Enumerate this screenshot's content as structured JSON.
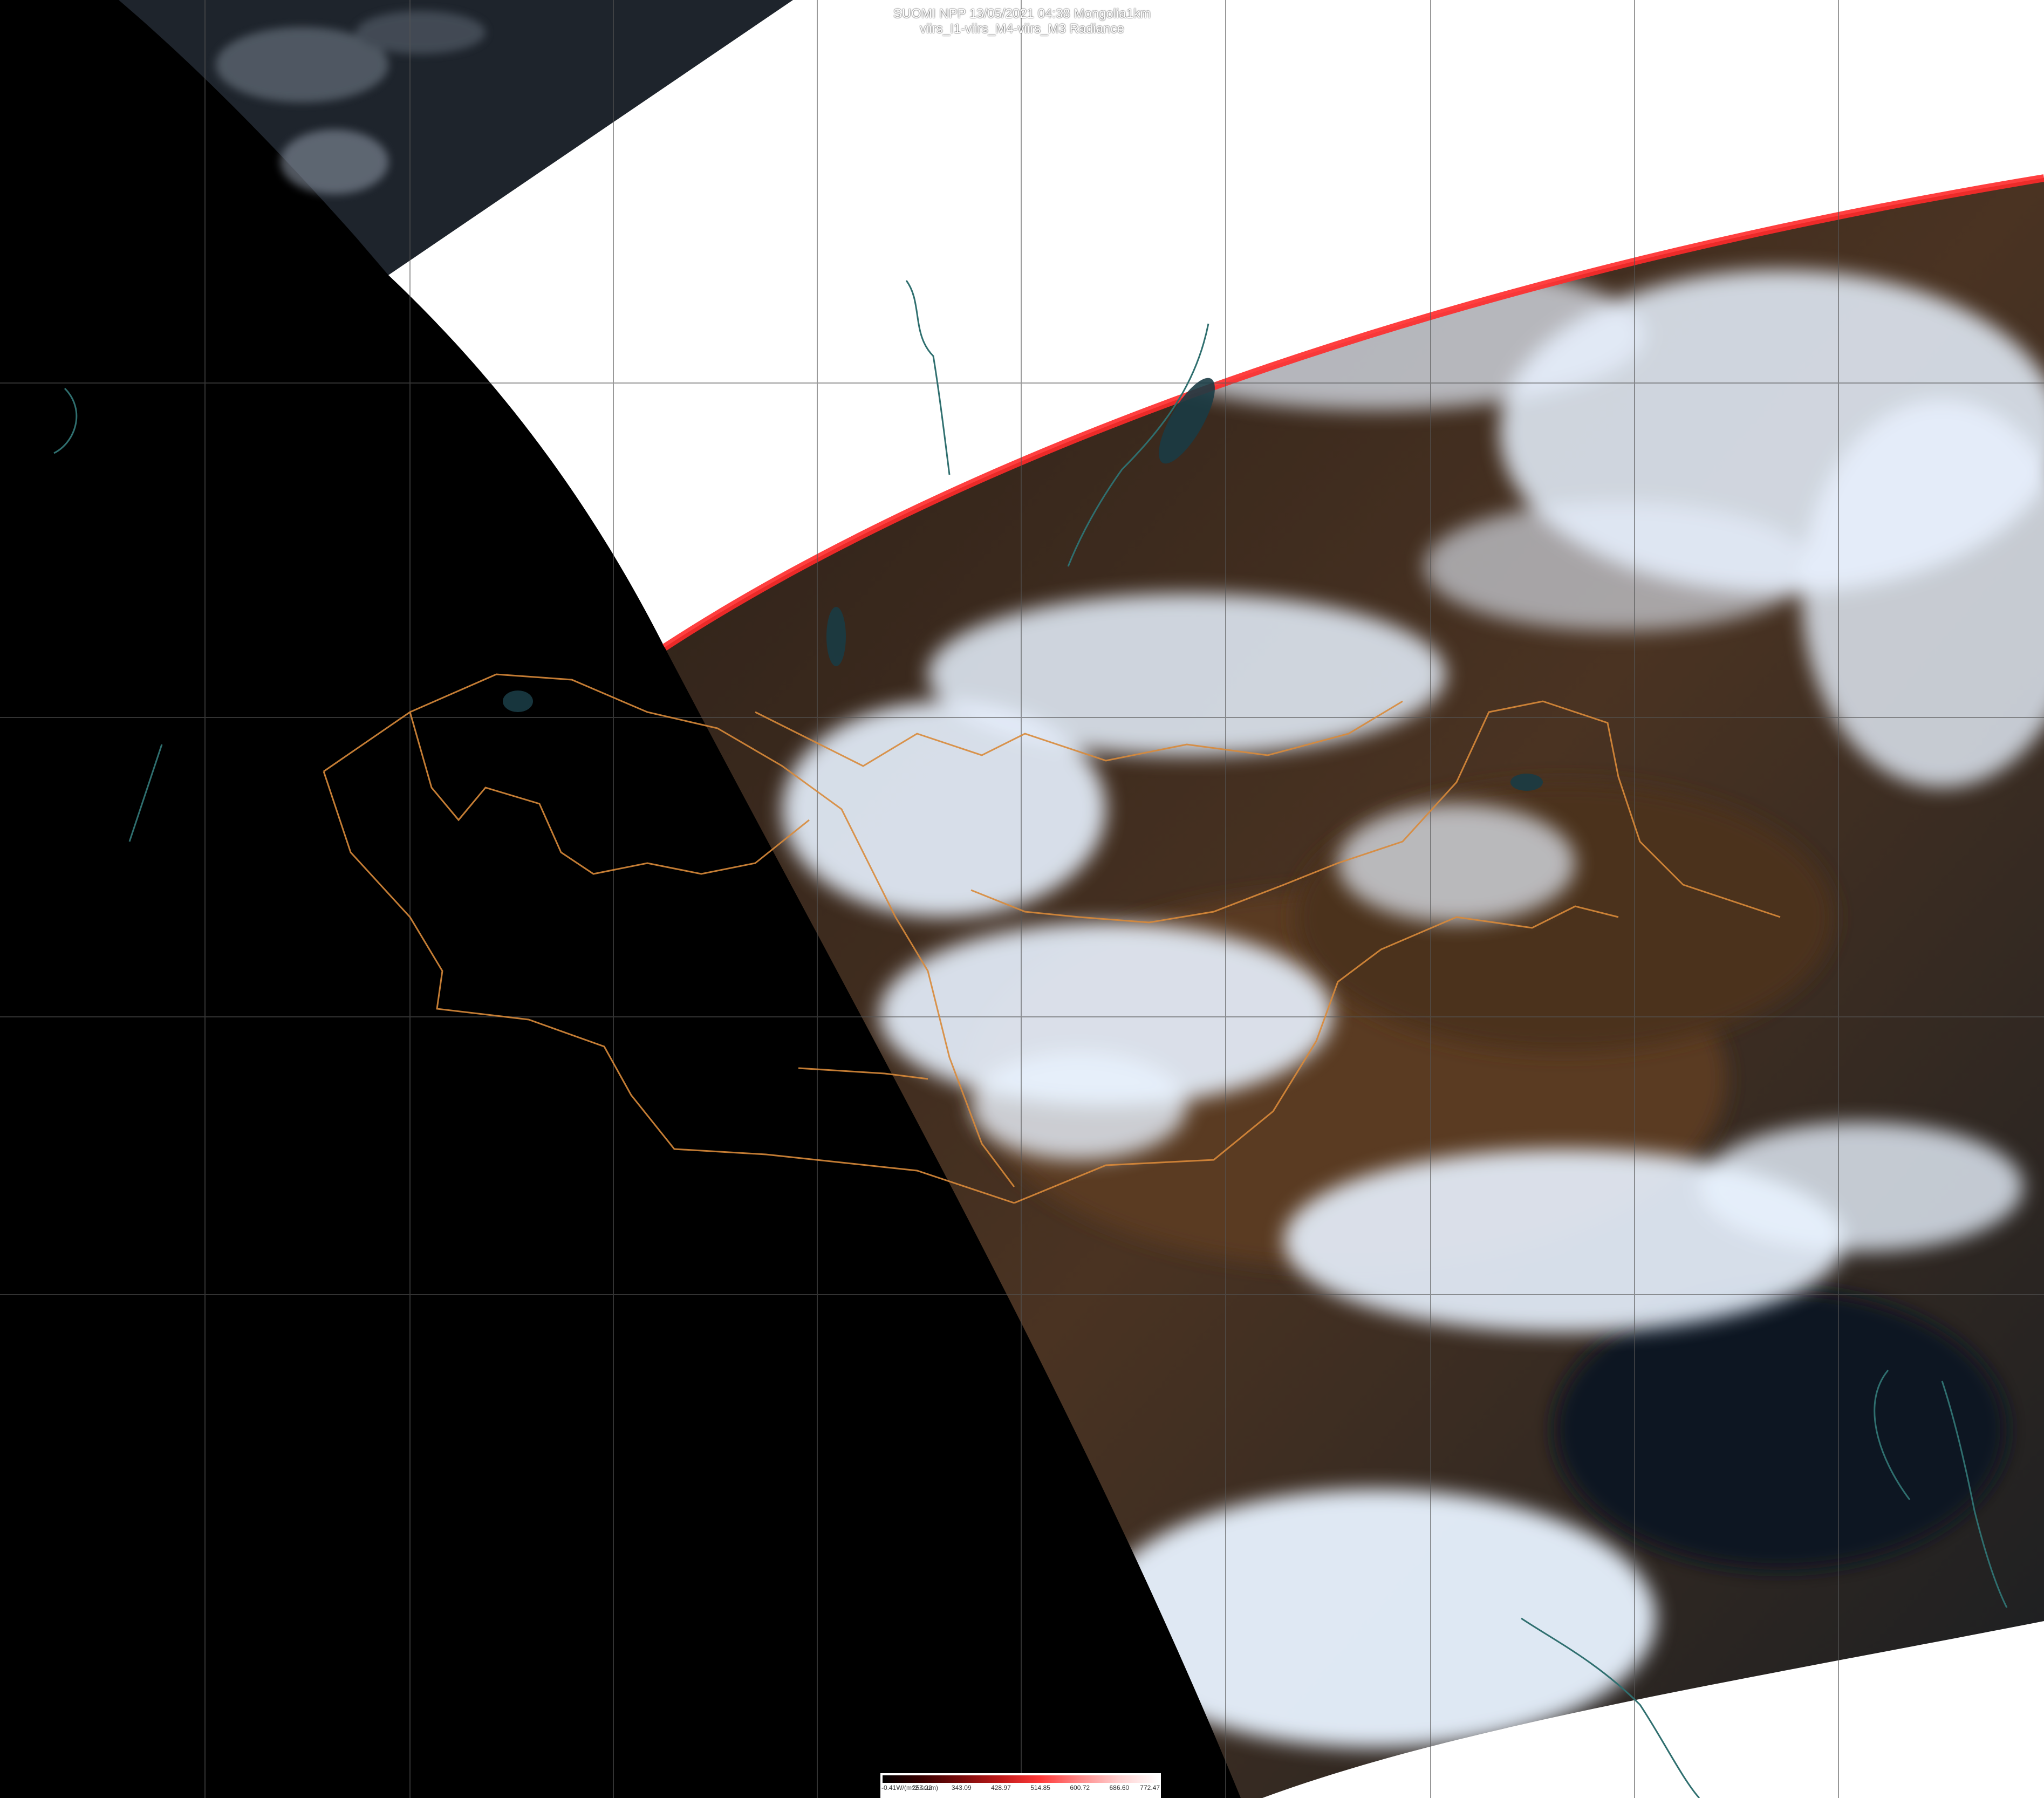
{
  "title": {
    "line1": "SUOMI NPP 13/05/2021 04:38 Mongolia1km",
    "line2": "viirs_I1-viirs_M4-viirs_M3 Radiance"
  },
  "legend": {
    "ticks": [
      "-0.41W/(m^2.sr.um)",
      "257.22",
      "343.09",
      "428.97",
      "514.85",
      "600.72",
      "686.60",
      "772.47"
    ],
    "colors": [
      "#000000",
      "#3a0000",
      "#7a0b0b",
      "#c01a1a",
      "#ff3a3a",
      "#ff8a8a",
      "#ffd0d0",
      "#ffffff"
    ]
  },
  "colors": {
    "night": "#000000",
    "nodata": "#ffffff",
    "land": "#3b2a1e",
    "cloud": "#e8f2ff",
    "border": "#d98a3a",
    "coast": "#2f6f6f",
    "grid": "#555555",
    "edge": "#ff2a2a",
    "sea": "#0d1620"
  }
}
